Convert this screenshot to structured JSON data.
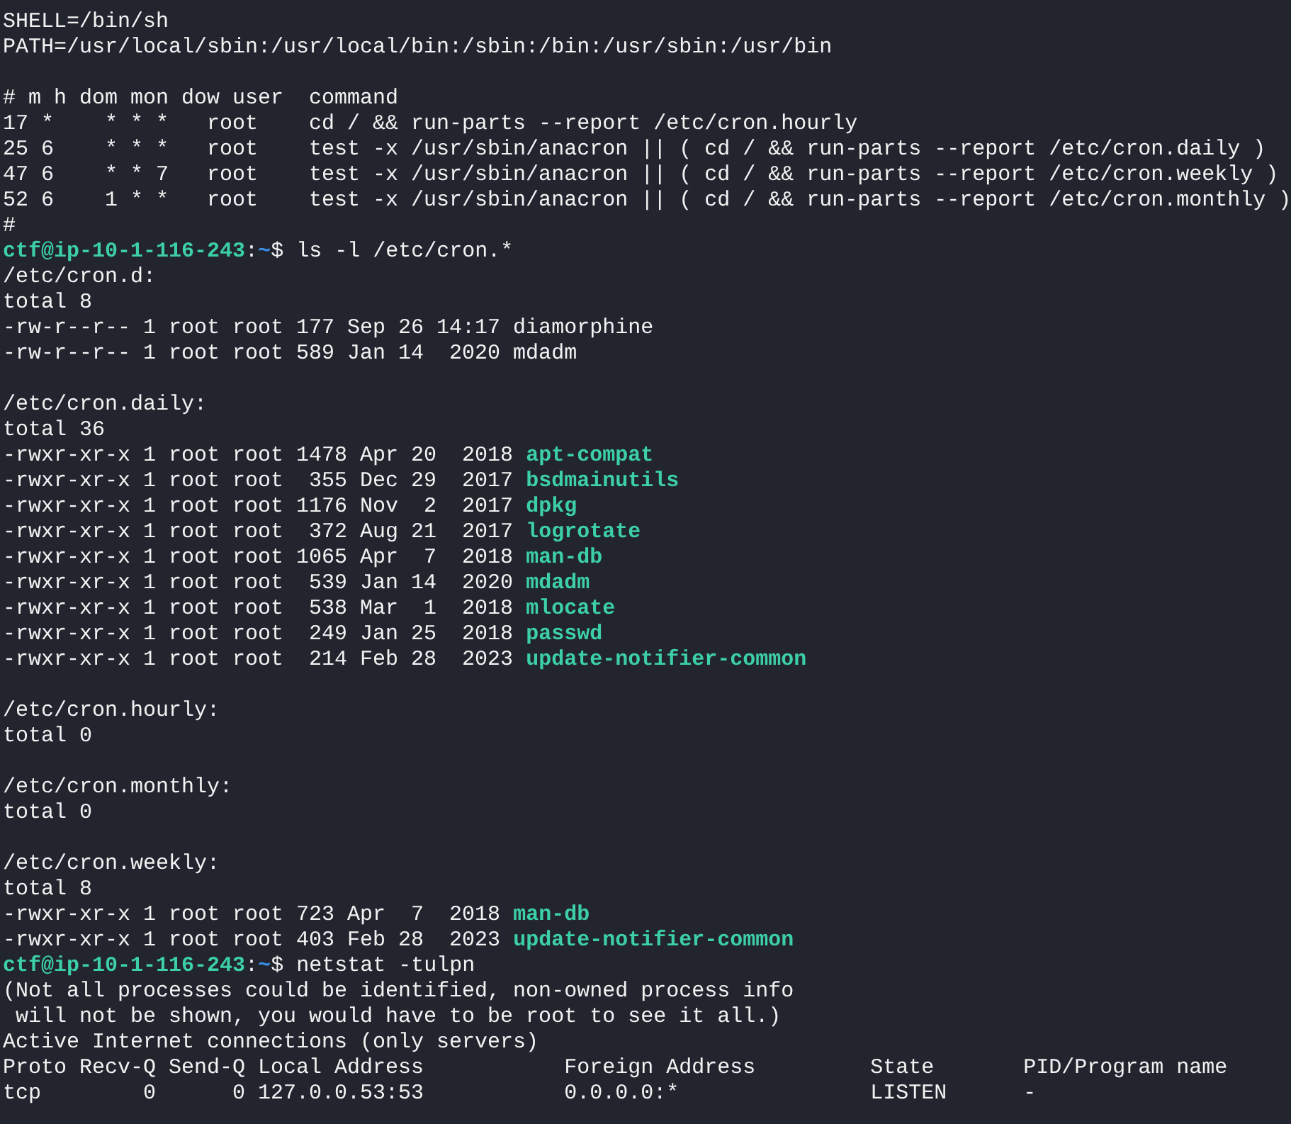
{
  "terminal": {
    "lines": [
      {
        "segments": [
          {
            "kind": "text",
            "text": "SHELL=/bin/sh"
          }
        ]
      },
      {
        "segments": [
          {
            "kind": "text",
            "text": "PATH=/usr/local/sbin:/usr/local/bin:/sbin:/bin:/usr/sbin:/usr/bin"
          }
        ]
      },
      {
        "gap_before": true,
        "segments": [
          {
            "kind": "text",
            "text": "# m h dom mon dow user  command"
          }
        ]
      },
      {
        "segments": [
          {
            "kind": "text",
            "text": "17 *    * * *   root    cd / && run-parts --report /etc/cron.hourly"
          }
        ]
      },
      {
        "segments": [
          {
            "kind": "text",
            "text": "25 6    * * *   root    test -x /usr/sbin/anacron || ( cd / && run-parts --report /etc/cron.daily )"
          }
        ]
      },
      {
        "segments": [
          {
            "kind": "text",
            "text": "47 6    * * 7   root    test -x /usr/sbin/anacron || ( cd / && run-parts --report /etc/cron.weekly )"
          }
        ]
      },
      {
        "segments": [
          {
            "kind": "text",
            "text": "52 6    1 * *   root    test -x /usr/sbin/anacron || ( cd / && run-parts --report /etc/cron.monthly )"
          }
        ]
      },
      {
        "segments": [
          {
            "kind": "text",
            "text": "#"
          }
        ]
      },
      {
        "segments": [
          {
            "kind": "user",
            "text": "ctf@ip-10-1-116-243"
          },
          {
            "kind": "sep",
            "text": ":"
          },
          {
            "kind": "cwd",
            "text": "~"
          },
          {
            "kind": "command",
            "text": "$ ls -l /etc/cron.*"
          }
        ]
      },
      {
        "segments": [
          {
            "kind": "text",
            "text": "/etc/cron.d:"
          }
        ]
      },
      {
        "segments": [
          {
            "kind": "text",
            "text": "total 8"
          }
        ]
      },
      {
        "segments": [
          {
            "kind": "text",
            "text": "-rw-r--r-- 1 root root 177 Sep 26 14:17 diamorphine"
          }
        ]
      },
      {
        "segments": [
          {
            "kind": "text",
            "text": "-rw-r--r-- 1 root root 589 Jan 14  2020 mdadm"
          }
        ]
      },
      {
        "gap_before": true,
        "segments": [
          {
            "kind": "text",
            "text": "/etc/cron.daily:"
          }
        ]
      },
      {
        "segments": [
          {
            "kind": "text",
            "text": "total 36"
          }
        ]
      },
      {
        "segments": [
          {
            "kind": "details",
            "text": "-rwxr-xr-x 1 root root 1478 Apr 20  2018 "
          },
          {
            "kind": "exec",
            "text": "apt-compat"
          }
        ]
      },
      {
        "segments": [
          {
            "kind": "details",
            "text": "-rwxr-xr-x 1 root root  355 Dec 29  2017 "
          },
          {
            "kind": "exec",
            "text": "bsdmainutils"
          }
        ]
      },
      {
        "segments": [
          {
            "kind": "details",
            "text": "-rwxr-xr-x 1 root root 1176 Nov  2  2017 "
          },
          {
            "kind": "exec",
            "text": "dpkg"
          }
        ]
      },
      {
        "segments": [
          {
            "kind": "details",
            "text": "-rwxr-xr-x 1 root root  372 Aug 21  2017 "
          },
          {
            "kind": "exec",
            "text": "logrotate"
          }
        ]
      },
      {
        "segments": [
          {
            "kind": "details",
            "text": "-rwxr-xr-x 1 root root 1065 Apr  7  2018 "
          },
          {
            "kind": "exec",
            "text": "man-db"
          }
        ]
      },
      {
        "segments": [
          {
            "kind": "details",
            "text": "-rwxr-xr-x 1 root root  539 Jan 14  2020 "
          },
          {
            "kind": "exec",
            "text": "mdadm"
          }
        ]
      },
      {
        "segments": [
          {
            "kind": "details",
            "text": "-rwxr-xr-x 1 root root  538 Mar  1  2018 "
          },
          {
            "kind": "exec",
            "text": "mlocate"
          }
        ]
      },
      {
        "segments": [
          {
            "kind": "details",
            "text": "-rwxr-xr-x 1 root root  249 Jan 25  2018 "
          },
          {
            "kind": "exec",
            "text": "passwd"
          }
        ]
      },
      {
        "segments": [
          {
            "kind": "details",
            "text": "-rwxr-xr-x 1 root root  214 Feb 28  2023 "
          },
          {
            "kind": "exec",
            "text": "update-notifier-common"
          }
        ]
      },
      {
        "gap_before": true,
        "segments": [
          {
            "kind": "text",
            "text": "/etc/cron.hourly:"
          }
        ]
      },
      {
        "segments": [
          {
            "kind": "text",
            "text": "total 0"
          }
        ]
      },
      {
        "gap_before": true,
        "segments": [
          {
            "kind": "text",
            "text": "/etc/cron.monthly:"
          }
        ]
      },
      {
        "segments": [
          {
            "kind": "text",
            "text": "total 0"
          }
        ]
      },
      {
        "gap_before": true,
        "segments": [
          {
            "kind": "text",
            "text": "/etc/cron.weekly:"
          }
        ]
      },
      {
        "segments": [
          {
            "kind": "text",
            "text": "total 8"
          }
        ]
      },
      {
        "segments": [
          {
            "kind": "details",
            "text": "-rwxr-xr-x 1 root root 723 Apr  7  2018 "
          },
          {
            "kind": "exec",
            "text": "man-db"
          }
        ]
      },
      {
        "segments": [
          {
            "kind": "details",
            "text": "-rwxr-xr-x 1 root root 403 Feb 28  2023 "
          },
          {
            "kind": "exec",
            "text": "update-notifier-common"
          }
        ]
      },
      {
        "segments": [
          {
            "kind": "user",
            "text": "ctf@ip-10-1-116-243"
          },
          {
            "kind": "sep",
            "text": ":"
          },
          {
            "kind": "cwd",
            "text": "~"
          },
          {
            "kind": "command",
            "text": "$ netstat -tulpn"
          }
        ]
      },
      {
        "segments": [
          {
            "kind": "text",
            "text": "(Not all processes could be identified, non-owned process info"
          }
        ]
      },
      {
        "segments": [
          {
            "kind": "text",
            "text": " will not be shown, you would have to be root to see it all.)"
          }
        ]
      },
      {
        "segments": [
          {
            "kind": "text",
            "text": "Active Internet connections (only servers)"
          }
        ]
      },
      {
        "segments": [
          {
            "kind": "text",
            "text": "Proto Recv-Q Send-Q Local Address           Foreign Address         State       PID/Program name"
          }
        ]
      },
      {
        "segments": [
          {
            "kind": "text",
            "text": "tcp        0      0 127.0.0.53:53           0.0.0.0:*               LISTEN      -"
          }
        ]
      }
    ]
  }
}
